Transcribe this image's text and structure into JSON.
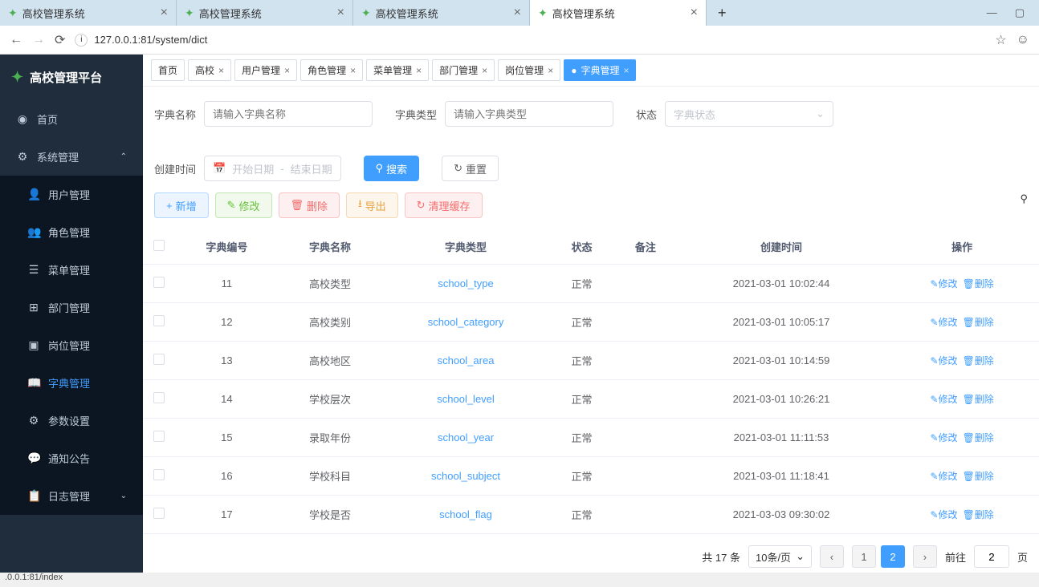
{
  "browser": {
    "tabs": [
      "高校管理系统",
      "高校管理系统",
      "高校管理系统",
      "高校管理系统"
    ],
    "active_tab": 3,
    "url": "127.0.0.1:81/system/dict",
    "status": ".0.0.1:81/index"
  },
  "app": {
    "title": "高校管理平台"
  },
  "sidebar": [
    {
      "icon": "dashboard",
      "label": "首页",
      "sub": false
    },
    {
      "icon": "gear",
      "label": "系统管理",
      "sub": false,
      "expanded": true
    },
    {
      "icon": "user",
      "label": "用户管理",
      "sub": true
    },
    {
      "icon": "users",
      "label": "角色管理",
      "sub": true
    },
    {
      "icon": "menu",
      "label": "菜单管理",
      "sub": true
    },
    {
      "icon": "tree",
      "label": "部门管理",
      "sub": true
    },
    {
      "icon": "post",
      "label": "岗位管理",
      "sub": true
    },
    {
      "icon": "dict",
      "label": "字典管理",
      "sub": true,
      "active": true
    },
    {
      "icon": "param",
      "label": "参数设置",
      "sub": true
    },
    {
      "icon": "notice",
      "label": "通知公告",
      "sub": true
    },
    {
      "icon": "log",
      "label": "日志管理",
      "sub": true,
      "chevron": true
    }
  ],
  "page_tabs": [
    {
      "label": "首页",
      "closable": false
    },
    {
      "label": "高校",
      "closable": true
    },
    {
      "label": "用户管理",
      "closable": true
    },
    {
      "label": "角色管理",
      "closable": true
    },
    {
      "label": "菜单管理",
      "closable": true
    },
    {
      "label": "部门管理",
      "closable": true
    },
    {
      "label": "岗位管理",
      "closable": true
    },
    {
      "label": "字典管理",
      "closable": true,
      "active": true
    }
  ],
  "filters": {
    "name_label": "字典名称",
    "name_ph": "请输入字典名称",
    "type_label": "字典类型",
    "type_ph": "请输入字典类型",
    "status_label": "状态",
    "status_ph": "字典状态",
    "time_label": "创建时间",
    "start_ph": "开始日期",
    "end_ph": "结束日期",
    "search": "搜索",
    "reset": "重置"
  },
  "toolbar": {
    "add": "新增",
    "edit": "修改",
    "del": "删除",
    "export": "导出",
    "clear": "清理缓存"
  },
  "table": {
    "headers": [
      "字典编号",
      "字典名称",
      "字典类型",
      "状态",
      "备注",
      "创建时间",
      "操作"
    ],
    "rows": [
      {
        "id": "11",
        "name": "高校类型",
        "type": "school_type",
        "status": "正常",
        "remark": "",
        "time": "2021-03-01 10:02:44"
      },
      {
        "id": "12",
        "name": "高校类别",
        "type": "school_category",
        "status": "正常",
        "remark": "",
        "time": "2021-03-01 10:05:17"
      },
      {
        "id": "13",
        "name": "高校地区",
        "type": "school_area",
        "status": "正常",
        "remark": "",
        "time": "2021-03-01 10:14:59"
      },
      {
        "id": "14",
        "name": "学校层次",
        "type": "school_level",
        "status": "正常",
        "remark": "",
        "time": "2021-03-01 10:26:21"
      },
      {
        "id": "15",
        "name": "录取年份",
        "type": "school_year",
        "status": "正常",
        "remark": "",
        "time": "2021-03-01 11:11:53"
      },
      {
        "id": "16",
        "name": "学校科目",
        "type": "school_subject",
        "status": "正常",
        "remark": "",
        "time": "2021-03-01 11:18:41"
      },
      {
        "id": "17",
        "name": "学校是否",
        "type": "school_flag",
        "status": "正常",
        "remark": "",
        "time": "2021-03-03 09:30:02"
      }
    ],
    "act_edit": "修改",
    "act_del": "删除"
  },
  "pager": {
    "total": "共 17 条",
    "per_page": "10条/页",
    "pages": [
      "1",
      "2"
    ],
    "active": "2",
    "goto_label": "前往",
    "goto_value": "2",
    "goto_suffix": "页"
  }
}
